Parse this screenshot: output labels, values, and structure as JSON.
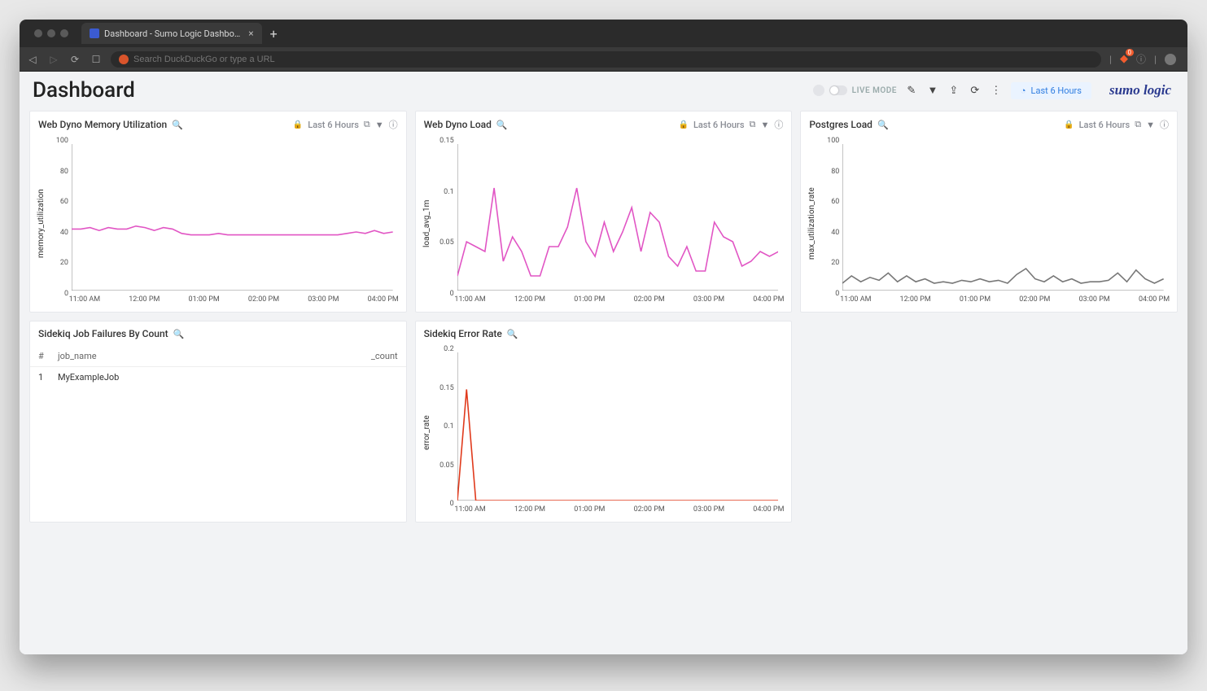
{
  "browser": {
    "tab_title": "Dashboard - Sumo Logic Dashbo…",
    "url_placeholder": "Search DuckDuckGo or type a URL",
    "shield_badge": "0"
  },
  "header": {
    "page_title": "Dashboard",
    "live_mode_label": "LIVE MODE",
    "time_label": "Last 6 Hours",
    "brand": "sumo logic"
  },
  "panels": {
    "mem": {
      "title": "Web Dyno Memory Utilization",
      "time": "Last 6 Hours"
    },
    "load": {
      "title": "Web Dyno Load",
      "time": "Last 6 Hours"
    },
    "pg": {
      "title": "Postgres Load",
      "time": "Last 6 Hours"
    },
    "fail": {
      "title": "Sidekiq Job Failures By Count",
      "col_num": "#",
      "col_job": "job_name",
      "col_count": "_count",
      "row1_n": "1",
      "row1_job": "MyExampleJob"
    },
    "err": {
      "title": "Sidekiq Error Rate"
    }
  },
  "x_ticks": [
    "11:00 AM",
    "12:00 PM",
    "01:00 PM",
    "02:00 PM",
    "03:00 PM",
    "04:00 PM"
  ],
  "chart_data": [
    {
      "id": "mem",
      "type": "line",
      "title": "Web Dyno Memory Utilization",
      "ylabel": "memory_utilization",
      "ylim": [
        0,
        100
      ],
      "yticks": [
        0,
        20,
        40,
        60,
        80,
        100
      ],
      "x": [
        "11:00 AM",
        "12:00 PM",
        "01:00 PM",
        "02:00 PM",
        "03:00 PM",
        "04:00 PM"
      ],
      "series": [
        {
          "name": "memory_utilization",
          "color": "#e155c4",
          "values": [
            42,
            42,
            43,
            41,
            43,
            42,
            42,
            44,
            43,
            41,
            43,
            42,
            39,
            38,
            38,
            38,
            39,
            38,
            38,
            38,
            38,
            38,
            38,
            38,
            38,
            38,
            38,
            38,
            38,
            38,
            39,
            40,
            39,
            41,
            39,
            40
          ]
        }
      ]
    },
    {
      "id": "load",
      "type": "line",
      "title": "Web Dyno Load",
      "ylabel": "load_avg_1m",
      "ylim": [
        0,
        0.15
      ],
      "yticks": [
        0,
        0.05,
        0.1,
        0.15
      ],
      "x": [
        "11:00 AM",
        "12:00 PM",
        "01:00 PM",
        "02:00 PM",
        "03:00 PM",
        "04:00 PM"
      ],
      "series": [
        {
          "name": "load_avg_1m",
          "color": "#e155c4",
          "values": [
            0.015,
            0.05,
            0.045,
            0.04,
            0.105,
            0.03,
            0.055,
            0.04,
            0.015,
            0.015,
            0.045,
            0.045,
            0.065,
            0.105,
            0.05,
            0.035,
            0.07,
            0.04,
            0.06,
            0.085,
            0.04,
            0.08,
            0.07,
            0.035,
            0.025,
            0.045,
            0.02,
            0.02,
            0.07,
            0.055,
            0.05,
            0.025,
            0.03,
            0.04,
            0.035,
            0.04
          ]
        }
      ]
    },
    {
      "id": "pg",
      "type": "line",
      "title": "Postgres Load",
      "ylabel": "max_utilization_rate",
      "ylim": [
        0,
        100
      ],
      "yticks": [
        0,
        20,
        40,
        60,
        80,
        100
      ],
      "x": [
        "11:00 AM",
        "12:00 PM",
        "01:00 PM",
        "02:00 PM",
        "03:00 PM",
        "04:00 PM"
      ],
      "series": [
        {
          "name": "max_utilization_rate",
          "color": "#777",
          "values": [
            5,
            10,
            6,
            9,
            7,
            12,
            6,
            10,
            6,
            8,
            5,
            6,
            5,
            7,
            6,
            8,
            6,
            7,
            5,
            11,
            15,
            8,
            6,
            10,
            6,
            8,
            5,
            6,
            6,
            7,
            12,
            6,
            14,
            8,
            5,
            8
          ]
        }
      ]
    },
    {
      "id": "err",
      "type": "line",
      "title": "Sidekiq Error Rate",
      "ylabel": "error_rate",
      "ylim": [
        0,
        0.2
      ],
      "yticks": [
        0,
        0.05,
        0.1,
        0.15,
        0.2
      ],
      "x": [
        "11:00 AM",
        "12:00 PM",
        "01:00 PM",
        "02:00 PM",
        "03:00 PM",
        "04:00 PM"
      ],
      "series": [
        {
          "name": "error_rate",
          "color": "#e03a1c",
          "values": [
            0,
            0.15,
            0,
            0,
            0,
            0,
            0,
            0,
            0,
            0,
            0,
            0,
            0,
            0,
            0,
            0,
            0,
            0,
            0,
            0,
            0,
            0,
            0,
            0,
            0,
            0,
            0,
            0,
            0,
            0,
            0,
            0,
            0,
            0,
            0,
            0
          ]
        }
      ]
    }
  ]
}
